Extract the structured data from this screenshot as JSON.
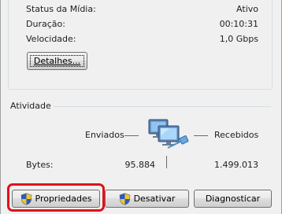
{
  "connection": {
    "rows": [
      {
        "label": "Status da Mídia:",
        "value": "Ativo"
      },
      {
        "label": "Duração:",
        "value": "00:10:31"
      },
      {
        "label": "Velocidade:",
        "value": "1,0 Gbps"
      }
    ],
    "details_button": "Detalhes..."
  },
  "activity": {
    "title": "Atividade",
    "sent_label": "Enviados",
    "received_label": "Recebidos",
    "bytes_label": "Bytes:",
    "bytes_sent": "95.884",
    "bytes_received": "1.499.013"
  },
  "buttons": {
    "properties": "Propriedades",
    "disable": "Desativar",
    "diagnose": "Diagnosticar"
  },
  "highlight_color": "#e0101a"
}
